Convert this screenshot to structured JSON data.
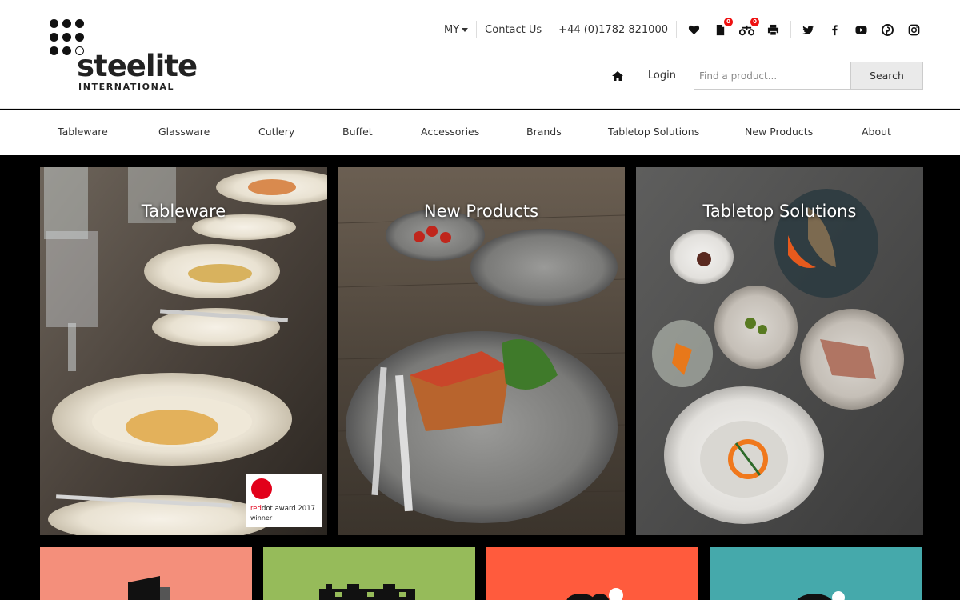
{
  "brand": {
    "name": "steelite",
    "sub": "INTERNATIONAL"
  },
  "topbar": {
    "region": "MY",
    "contact": "Contact Us",
    "phone": "+44 (0)1782 821000",
    "icons": [
      {
        "name": "heart-icon",
        "badge": null
      },
      {
        "name": "document-icon",
        "badge": "0"
      },
      {
        "name": "compare-scales-icon",
        "badge": "0"
      },
      {
        "name": "print-icon",
        "badge": null
      }
    ],
    "social": [
      "twitter-icon",
      "facebook-icon",
      "youtube-icon",
      "pinterest-icon",
      "instagram-icon"
    ]
  },
  "account": {
    "home_icon": "home-icon",
    "login": "Login"
  },
  "search": {
    "placeholder": "Find a product...",
    "button": "Search"
  },
  "nav": [
    "Tableware",
    "Glassware",
    "Cutlery",
    "Buffet",
    "Accessories",
    "Brands",
    "Tabletop Solutions",
    "New Products",
    "About"
  ],
  "tiles": [
    {
      "title": "Tableware"
    },
    {
      "title": "New Products"
    },
    {
      "title": "Tabletop Solutions"
    }
  ],
  "award": {
    "brand_red": "red",
    "brand_dot": "dot",
    "award_text": " award 2017",
    "winner": "winner"
  },
  "bottom_tiles": [
    {
      "color": "#f48f7b"
    },
    {
      "color": "#96bb5a"
    },
    {
      "color": "#ff5b3d"
    },
    {
      "color": "#45a9ab"
    }
  ],
  "colors": {
    "badge": "#e11111",
    "reddot": "#e2001a"
  }
}
